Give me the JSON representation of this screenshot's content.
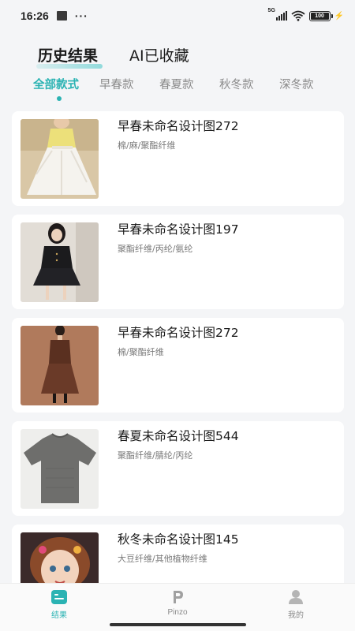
{
  "status_bar": {
    "time": "16:26",
    "dots": "···",
    "network": "5G",
    "battery": "100"
  },
  "main_tabs": [
    {
      "label": "历史结果",
      "active": true
    },
    {
      "label": "AI已收藏",
      "active": false
    }
  ],
  "category_tabs": [
    {
      "label": "全部款式",
      "active": true
    },
    {
      "label": "早春款",
      "active": false
    },
    {
      "label": "春夏款",
      "active": false
    },
    {
      "label": "秋冬款",
      "active": false
    },
    {
      "label": "深冬款",
      "active": false
    }
  ],
  "designs": [
    {
      "title": "早春未命名设计图272",
      "materials": "棉/麻/聚酯纤维"
    },
    {
      "title": "早春未命名设计图197",
      "materials": "聚酯纤维/丙纶/氨纶"
    },
    {
      "title": "早春未命名设计图272",
      "materials": "棉/聚酯纤维"
    },
    {
      "title": "春夏未命名设计图544",
      "materials": "聚酯纤维/腈纶/丙纶"
    },
    {
      "title": "秋冬未命名设计图145",
      "materials": "大豆纤维/其他植物纤维"
    }
  ],
  "bottom_nav": [
    {
      "label": "结果",
      "icon": "result-icon",
      "active": true
    },
    {
      "label": "Pinzo",
      "icon": "pinzo-logo-icon",
      "active": false
    },
    {
      "label": "我的",
      "icon": "profile-icon",
      "active": false
    }
  ],
  "colors": {
    "accent": "#2bb3b3",
    "background": "#f4f5f7",
    "card": "#ffffff"
  }
}
